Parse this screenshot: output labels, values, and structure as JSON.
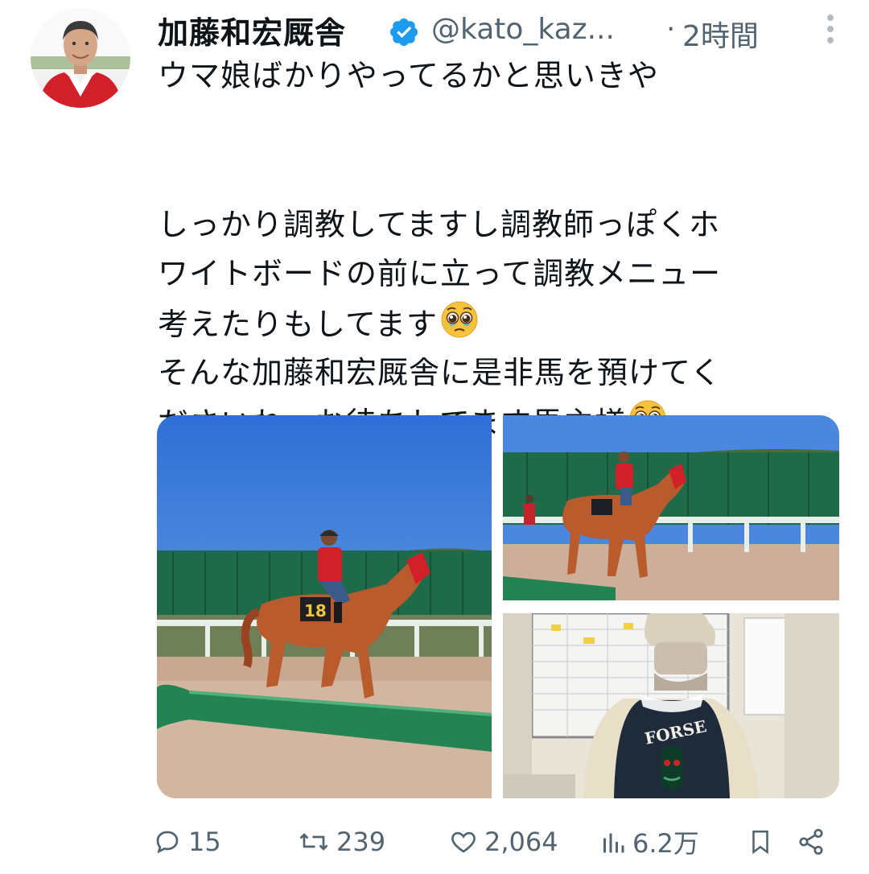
{
  "tweet": {
    "author_name": "加藤和宏厩舎",
    "handle": "@kato_kaz...",
    "separator": "·",
    "time": "2時間",
    "lines": [
      "ウマ娘ばかりやってるかと思いきや",
      "",
      "しっかり調教してますし調教師っぽくホ",
      "ワイトボードの前に立って調教メニュー",
      "考えたりもしてます",
      "そんな加藤和宏厩舎に是非馬を預けてく",
      "ださいね、お待ちしてます馬主様"
    ],
    "media": {
      "jacket_text": "FORSE",
      "saddle_number": "18"
    }
  },
  "actions": {
    "replies": "15",
    "retweets": "239",
    "likes": "2,064",
    "views": "6.2万"
  },
  "colors": {
    "verified": "#1d9bf0",
    "secondary_text": "#536471",
    "jacket_red": "#d2202b"
  },
  "icons": [
    "verified-badge-icon",
    "more-icon",
    "reply-icon",
    "retweet-icon",
    "like-icon",
    "views-icon",
    "bookmark-icon",
    "share-icon",
    "pleading-face-emoji"
  ]
}
